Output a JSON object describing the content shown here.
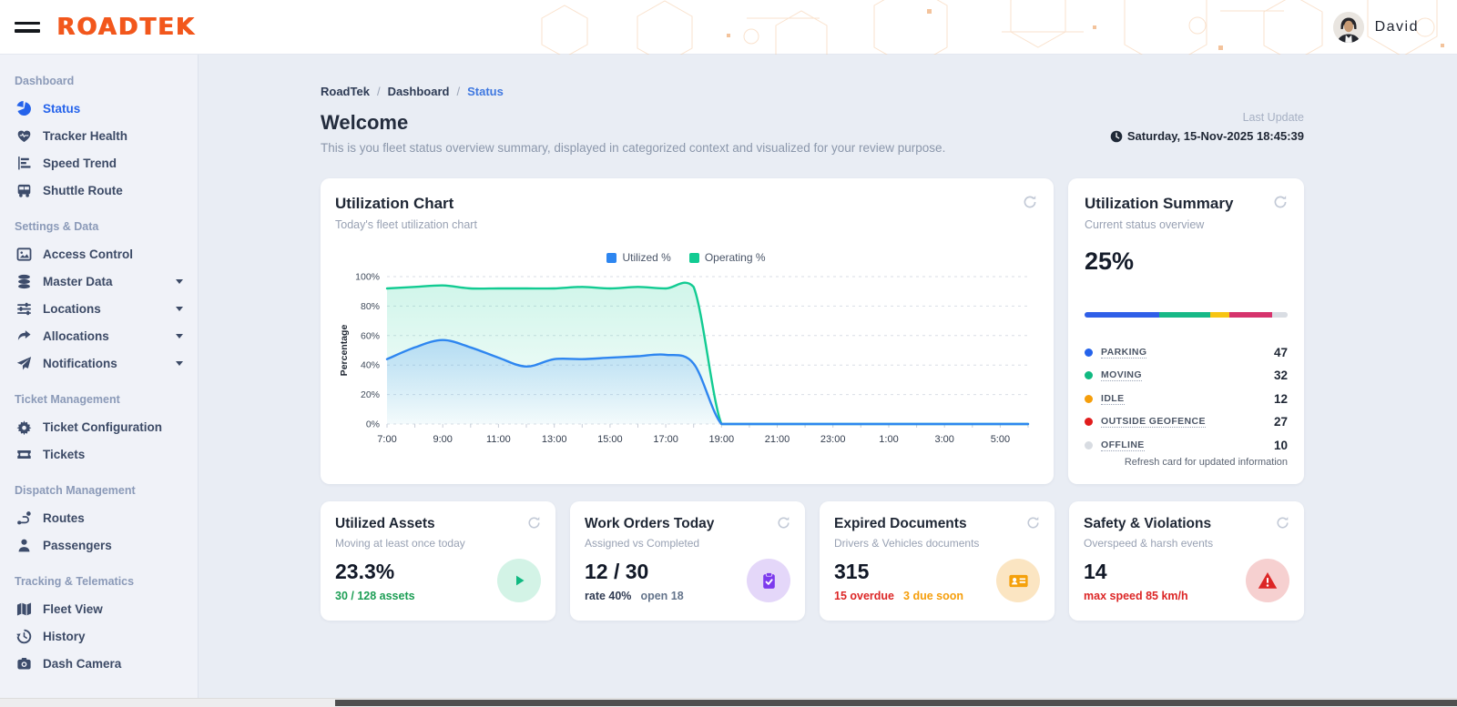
{
  "header": {
    "logo": "ROADTEK",
    "user": {
      "name": "David"
    }
  },
  "sidebar": {
    "sections": [
      {
        "label": "Dashboard",
        "items": [
          {
            "label": "Status",
            "icon": "pie-chart",
            "active": true
          },
          {
            "label": "Tracker Health",
            "icon": "heart"
          },
          {
            "label": "Speed Trend",
            "icon": "bar-chart"
          },
          {
            "label": "Shuttle Route",
            "icon": "bus"
          }
        ]
      },
      {
        "label": "Settings & Data",
        "items": [
          {
            "label": "Access Control",
            "icon": "image-frame"
          },
          {
            "label": "Master Data",
            "icon": "database",
            "expandable": true
          },
          {
            "label": "Locations",
            "icon": "sliders",
            "expandable": true
          },
          {
            "label": "Allocations",
            "icon": "share-arrow",
            "expandable": true
          },
          {
            "label": "Notifications",
            "icon": "paper-plane",
            "expandable": true
          }
        ]
      },
      {
        "label": "Ticket Management",
        "items": [
          {
            "label": "Ticket Configuration",
            "icon": "gear"
          },
          {
            "label": "Tickets",
            "icon": "ticket"
          }
        ]
      },
      {
        "label": "Dispatch Management",
        "items": [
          {
            "label": "Routes",
            "icon": "route"
          },
          {
            "label": "Passengers",
            "icon": "person"
          }
        ]
      },
      {
        "label": "Tracking & Telematics",
        "items": [
          {
            "label": "Fleet View",
            "icon": "map"
          },
          {
            "label": "History",
            "icon": "history-clock"
          },
          {
            "label": "Dash Camera",
            "icon": "camera"
          }
        ]
      }
    ]
  },
  "breadcrumb": {
    "items": [
      "RoadTek",
      "Dashboard",
      "Status"
    ]
  },
  "page": {
    "title": "Welcome",
    "subtitle": "This is you fleet status overview summary, displayed in categorized context and visualized for your review purpose.",
    "last_update_label": "Last Update",
    "last_update_value": "Saturday, 15-Nov-2025 18:45:39"
  },
  "chart_card": {
    "title": "Utilization Chart",
    "subtitle": "Today's fleet utilization chart"
  },
  "chart_data": {
    "type": "line",
    "title": "Utilization Chart",
    "x": [
      "7:00",
      "8:00",
      "9:00",
      "10:00",
      "11:00",
      "12:00",
      "13:00",
      "14:00",
      "15:00",
      "16:00",
      "17:00",
      "18:00",
      "19:00",
      "20:00",
      "21:00",
      "22:00",
      "23:00",
      "0:00",
      "1:00",
      "2:00",
      "3:00",
      "4:00",
      "5:00",
      "6:00"
    ],
    "x_tick_step": 2,
    "ylabel": "Percentage",
    "ylim": [
      0,
      100
    ],
    "y_tick_values": [
      0,
      20,
      40,
      60,
      80,
      100
    ],
    "y_ticks": [
      "0%",
      "20%",
      "40%",
      "60%",
      "80%",
      "100%"
    ],
    "grid": true,
    "legend_position": "top",
    "series": [
      {
        "name": "Utilized %",
        "color": "#2e86f0",
        "values": [
          44,
          52,
          57,
          52,
          45,
          39,
          44,
          44,
          45,
          46,
          47,
          41,
          0,
          0,
          0,
          0,
          0,
          0,
          0,
          0,
          0,
          0,
          0,
          0
        ]
      },
      {
        "name": "Operating %",
        "color": "#12cb92",
        "values": [
          92,
          93,
          94,
          92,
          92,
          92,
          92,
          93,
          92,
          93,
          92,
          93,
          0,
          0,
          0,
          0,
          0,
          0,
          0,
          0,
          0,
          0,
          0,
          0
        ]
      }
    ]
  },
  "summary_card": {
    "title": "Utilization Summary",
    "subtitle": "Current status overview",
    "value": "25%",
    "footer": "Refresh card for updated information",
    "bar_track_color": "#d9dde3",
    "statuses": [
      {
        "label": "PARKING",
        "value": 47,
        "dot_color": "#2563eb",
        "bar_color": "#2f5fe8"
      },
      {
        "label": "MOVING",
        "value": 32,
        "dot_color": "#10b981",
        "bar_color": "#17b987"
      },
      {
        "label": "IDLE",
        "value": 12,
        "dot_color": "#f59e0b",
        "bar_color": "#f7c513"
      },
      {
        "label": "OUTSIDE GEOFENCE",
        "value": 27,
        "dot_color": "#e11d1d",
        "bar_color": "#d6336c"
      },
      {
        "label": "OFFLINE",
        "value": 10,
        "dot_color": "#d8dce2",
        "bar_color": "#d9dde3"
      }
    ]
  },
  "stat_cards": [
    {
      "title": "Utilized Assets",
      "subtitle": "Moving at least once today",
      "value": "23.3%",
      "details": [
        {
          "text": "30 / 128 assets",
          "color": "#1d9e55"
        }
      ],
      "icon": "play",
      "icon_color": "#10b981",
      "icon_bg": "#d3f3e6"
    },
    {
      "title": "Work Orders Today",
      "subtitle": "Assigned vs Completed",
      "value": "12 / 30",
      "details": [
        {
          "text": "rate 40%",
          "color": "#303b52"
        },
        {
          "text": "open 18",
          "color": "#64748b"
        }
      ],
      "icon": "clipboard-check",
      "icon_color": "#7c3aed",
      "icon_bg": "#e4d7f9"
    },
    {
      "title": "Expired Documents",
      "subtitle": "Drivers & Vehicles documents",
      "value": "315",
      "details": [
        {
          "text": "15 overdue",
          "color": "#dc2626"
        },
        {
          "text": "3 due soon",
          "color": "#f59e0b"
        }
      ],
      "icon": "id-card",
      "icon_color": "#f5a10c",
      "icon_bg": "#fbe5c2"
    },
    {
      "title": "Safety & Violations",
      "subtitle": "Overspeed & harsh events",
      "value": "14",
      "details": [
        {
          "text": "max speed 85 km/h",
          "color": "#dc2626"
        }
      ],
      "icon": "warning-triangle",
      "icon_color": "#dc2626",
      "icon_bg": "#f6d0d0"
    }
  ]
}
